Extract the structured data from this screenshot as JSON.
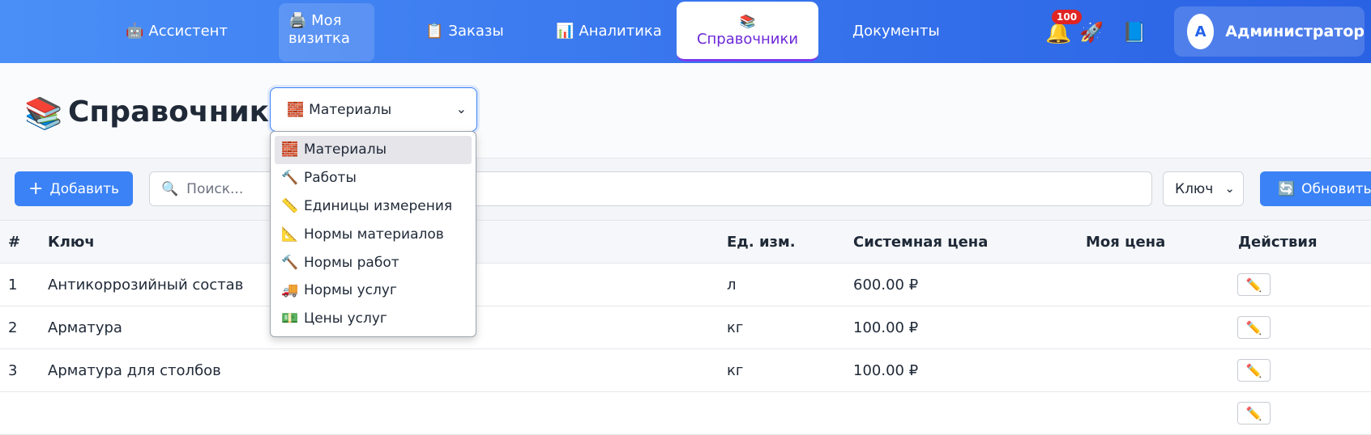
{
  "nav": {
    "items": [
      {
        "icon": "🤖",
        "label": "Ассистент"
      },
      {
        "icon": "🖨️",
        "label": "Моя визитка"
      },
      {
        "icon": "📋",
        "label": "Заказы"
      },
      {
        "icon": "📊",
        "label": "Аналитика"
      },
      {
        "icon": "📚",
        "label": "Справочники"
      },
      {
        "icon": "",
        "label": "Документы"
      }
    ],
    "notifications_count": "100",
    "user": {
      "initial": "A",
      "name": "Администратор"
    }
  },
  "page": {
    "icon": "📚",
    "title": "Справочники",
    "selected_catalog": {
      "icon": "🧱",
      "label": "Материалы"
    }
  },
  "dropdown": {
    "options": [
      {
        "icon": "🧱",
        "label": "Материалы",
        "selected": true
      },
      {
        "icon": "🔨",
        "label": "Работы"
      },
      {
        "icon": "📏",
        "label": "Единицы измерения"
      },
      {
        "icon": "📐",
        "label": "Нормы материалов"
      },
      {
        "icon": "🔨",
        "label": "Нормы работ"
      },
      {
        "icon": "🚚",
        "label": "Нормы услуг"
      },
      {
        "icon": "💵",
        "label": "Цены услуг"
      }
    ]
  },
  "toolbar": {
    "add_label": "Добавить",
    "search_placeholder": "Поиск...",
    "sort_value": "Ключ",
    "refresh_label": "Обновить"
  },
  "table": {
    "headers": [
      "#",
      "Ключ",
      "Ед. изм.",
      "Системная цена",
      "Моя цена",
      "Действия"
    ],
    "rows": [
      {
        "num": "1",
        "key": "Антикоррозийный состав",
        "unit": "л",
        "system_price": "600.00 ₽",
        "my_price": ""
      },
      {
        "num": "2",
        "key": "Арматура",
        "unit": "кг",
        "system_price": "100.00 ₽",
        "my_price": ""
      },
      {
        "num": "3",
        "key": "Арматура для столбов",
        "unit": "кг",
        "system_price": "100.00 ₽",
        "my_price": ""
      }
    ]
  }
}
